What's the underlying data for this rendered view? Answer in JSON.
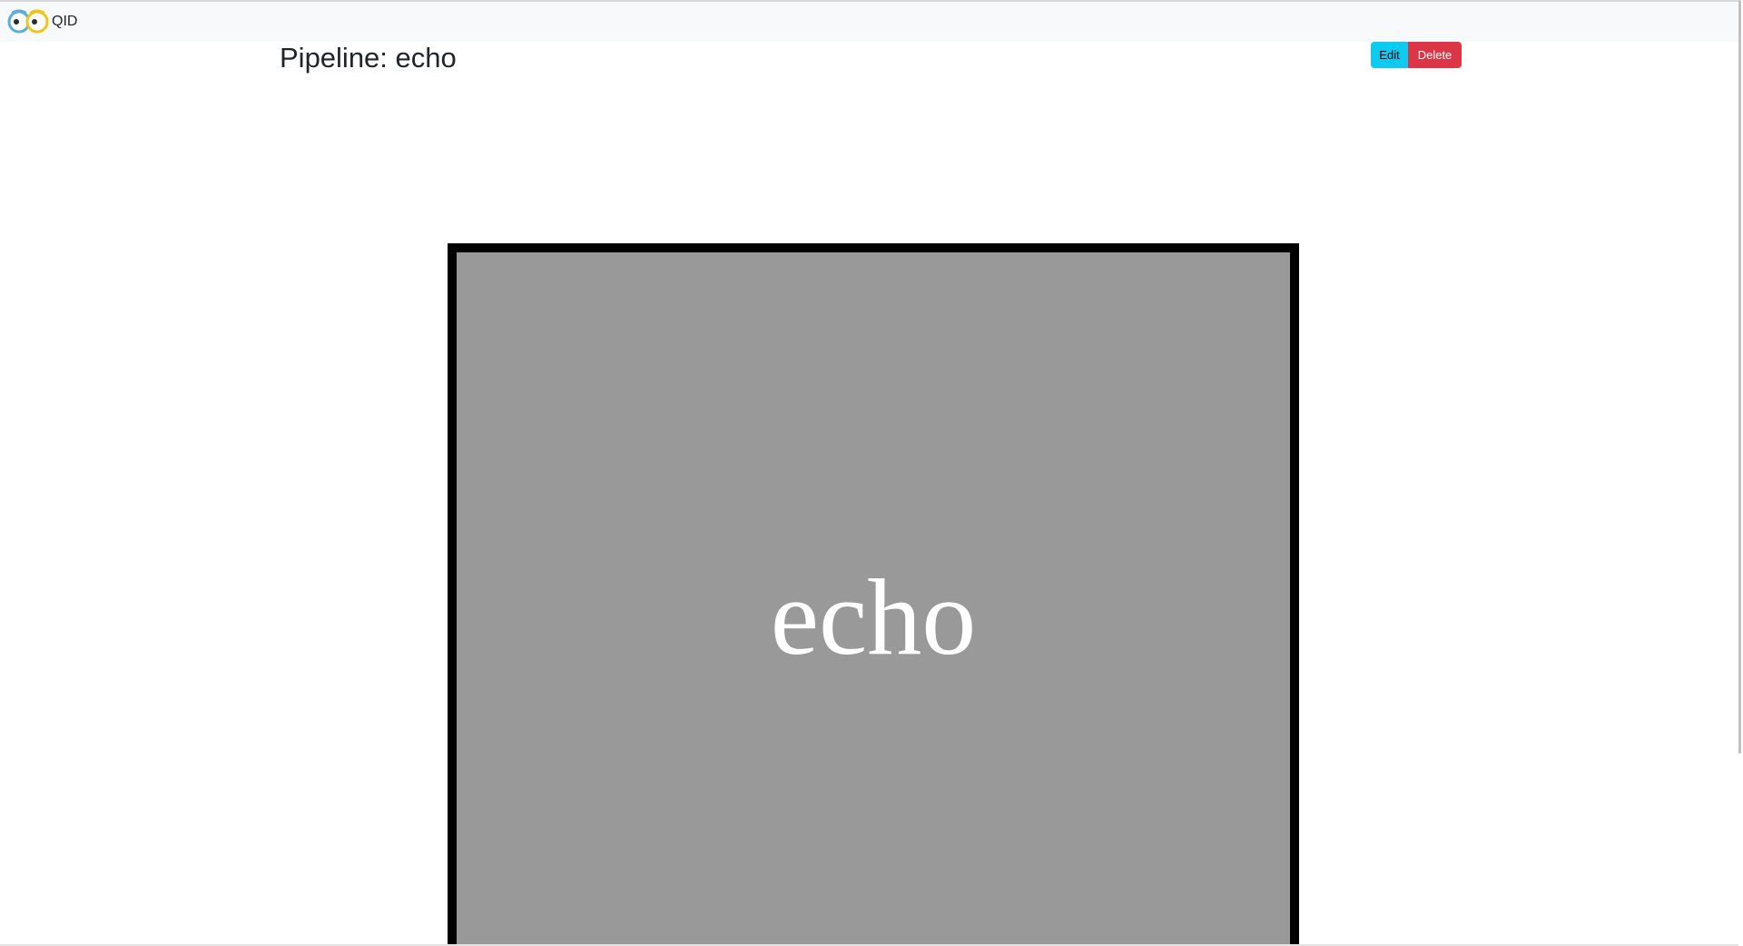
{
  "navbar": {
    "brand_text": "QID",
    "logo_icon": "owl-eyes-logo-icon"
  },
  "page": {
    "title": "Pipeline: echo"
  },
  "actions": {
    "edit_label": "Edit",
    "delete_label": "Delete"
  },
  "diagram": {
    "node_label": "echo"
  },
  "colors": {
    "navbar_bg": "#f8f9fa",
    "edit_button": "#0dcaf0",
    "delete_button": "#dc3545",
    "node_fill": "#999999",
    "node_border": "#000000",
    "node_text": "#ffffff"
  }
}
